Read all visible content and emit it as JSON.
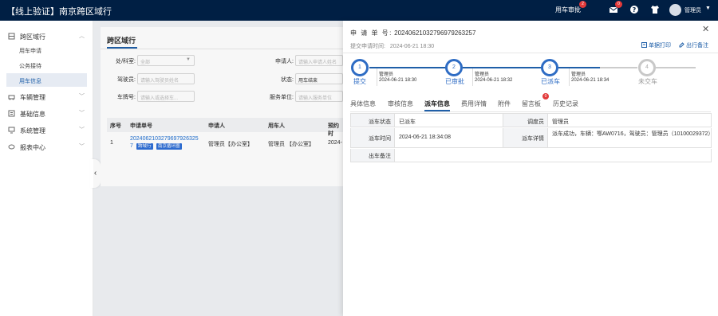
{
  "app": {
    "title": "【线上验证】南京跨区域行"
  },
  "topbar": {
    "car_approval_label": "用车审批",
    "car_approval_badge": "2",
    "mail_badge": "0",
    "mail_icon": "mail-icon",
    "help_icon": "help-icon",
    "skin_icon": "shirt-icon",
    "user_name": "管理员",
    "user_caret": "▼"
  },
  "sidebar": {
    "menus": [
      {
        "label": "跨区域行",
        "icon": "cross-region-icon",
        "expanded": true
      },
      {
        "label": "车辆管理",
        "icon": "car-icon",
        "expanded": false
      },
      {
        "label": "基础信息",
        "icon": "info-icon",
        "expanded": false
      },
      {
        "label": "系统管理",
        "icon": "system-icon",
        "expanded": false
      },
      {
        "label": "报表中心",
        "icon": "report-icon",
        "expanded": false
      }
    ],
    "submenus": [
      {
        "label": "用车申请"
      },
      {
        "label": "公务接待"
      },
      {
        "label": "用车信息",
        "active": true
      }
    ]
  },
  "main": {
    "page_title": "跨区域行",
    "filters": {
      "dept_label": "处/科室:",
      "dept_value": "全部",
      "applicant_label": "申请人:",
      "applicant_placeholder": "请输入申请人姓名",
      "driver_label": "驾驶员:",
      "driver_placeholder": "请输入驾驶员姓名",
      "status_label": "状态:",
      "status_value": "用车结束",
      "plate_label": "车牌号:",
      "plate_placeholder": "请输入或选择车...",
      "service_label": "服务单位:",
      "service_placeholder": "请输入服务单位"
    },
    "table": {
      "columns": [
        "序号",
        "申请单号",
        "申请人",
        "用车人",
        "预约时"
      ],
      "rows": [
        {
          "index": "1",
          "app_no_line1": "2024062103279697926325",
          "app_no_line2": "7",
          "tag1": "跨域行",
          "tag2": "南京循环圈",
          "applicant": "管理员【办公室】",
          "user": "管理员 【办公室】",
          "time": "2024-"
        }
      ]
    }
  },
  "drawer": {
    "app_no_label": "申 请 单 号:",
    "app_no_value": "20240621032796979263257",
    "submit_time_label": "提交申请时间:",
    "submit_time_value": "2024-06-21 18:30",
    "print_label": "单据打印",
    "remark_label": "出行备注",
    "steps": [
      {
        "num": "1",
        "label": "提交",
        "who": "管理员",
        "time": "2024-06-21 18:30",
        "done": true
      },
      {
        "num": "2",
        "label": "已审批",
        "who": "管理员",
        "time": "2024-06-21 18:32",
        "done": true
      },
      {
        "num": "3",
        "label": "已派车",
        "who": "管理员",
        "time": "2024-06-21 18:34",
        "done": true
      },
      {
        "num": "4",
        "label": "未交车",
        "who": "",
        "time": "",
        "done": false
      }
    ],
    "tabs": [
      "具体信息",
      "审核信息",
      "派车信息",
      "费用详情",
      "附件",
      "留言板",
      "历史记录"
    ],
    "active_tab": "派车信息",
    "message_badge": "0",
    "details": {
      "dispatch_status_label": "派车状态",
      "dispatch_status_value": "已派车",
      "dispatcher_label": "调度员",
      "dispatcher_value": "管理员",
      "dispatch_time_label": "派车时间",
      "dispatch_time_value": "2024-06-21 18:34:08",
      "dispatch_detail_label": "派车详情",
      "dispatch_detail_value": "派车成功，车辆：鄂AW0716，驾驶员：管理员（10100029372）",
      "out_remark_label": "出车备注",
      "out_remark_value": ""
    }
  },
  "colors": {
    "topbar": "#001f44",
    "accent": "#1f5fa8",
    "badge": "#e23a3a"
  }
}
